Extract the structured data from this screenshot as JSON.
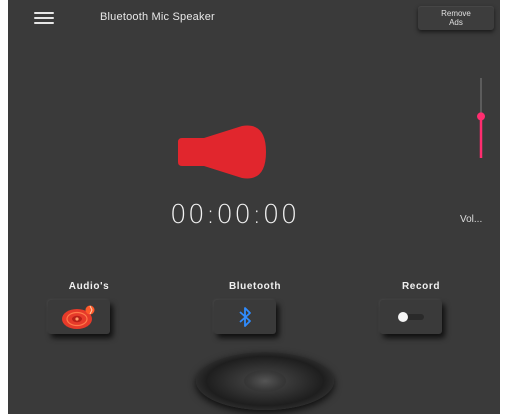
{
  "header": {
    "title": "Bluetooth Mic Speaker",
    "remove_ads_line1": "Remove",
    "remove_ads_line2": "Ads",
    "menu_icon": "hamburger-menu-icon"
  },
  "player": {
    "timer": "00:00:00",
    "speaker_icon": "speaker-icon",
    "volume_label": "Vol...",
    "volume_level": 0.52
  },
  "actions": [
    {
      "label": "Audio's",
      "icon": "audio-disc-icon"
    },
    {
      "label": "Bluetooth",
      "icon": "bluetooth-icon"
    },
    {
      "label": "Record",
      "icon": "record-toggle-icon"
    }
  ],
  "colors": {
    "background": "#3a3a3a",
    "accent_red": "#e1262d",
    "volume_accent": "#ff2d6f",
    "bluetooth_blue": "#2f8cff",
    "text": "#f2f2f2"
  }
}
